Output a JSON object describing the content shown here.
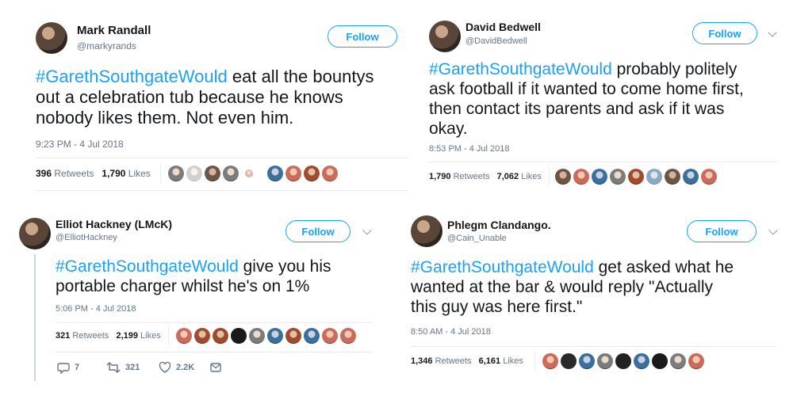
{
  "tweets": [
    {
      "name": "Mark Randall",
      "handle": "@markyrands",
      "follow": "Follow",
      "hashtag": "#GarethSouthgateWould",
      "text_lines": [
        " eat all the bountys",
        "out a celebration tub because he knows",
        "nobody likes them. Not even him."
      ],
      "timestamp": "9:23 PM - 4 Jul 2018",
      "retweets": "396",
      "retweets_label": "Retweets",
      "likes": "1,790",
      "likes_label": "Likes"
    },
    {
      "name": "David Bedwell",
      "handle": "@DavidBedwell",
      "follow": "Follow",
      "hashtag": "#GarethSouthgateWould",
      "text_lines": [
        " probably politely",
        "ask football if it wanted to come home first,",
        "then contact its parents and ask if it was",
        "okay."
      ],
      "timestamp": "8:53 PM - 4 Jul 2018",
      "retweets": "1,790",
      "retweets_label": "Retweets",
      "likes": "7,062",
      "likes_label": "Likes"
    },
    {
      "name": "Elliot Hackney (LMcK)",
      "handle": "@ElliotHackney",
      "follow": "Follow",
      "hashtag": "#GarethSouthgateWould",
      "text_lines": [
        " give you his",
        "portable charger whilst he's on 1%"
      ],
      "timestamp": "5:06 PM - 4 Jul 2018",
      "retweets": "321",
      "retweets_label": "Retweets",
      "likes": "2,199",
      "likes_label": "Likes",
      "actions": {
        "replies": "7",
        "retweets": "321",
        "likes": "2.2K"
      }
    },
    {
      "name": "Phlegm Clandango.",
      "handle": "@Cain_Unable",
      "follow": "Follow",
      "hashtag": "#GarethSouthgateWould",
      "text_lines": [
        " get asked what he",
        "wanted at the bar & would reply \"Actually",
        "this guy was here first.\""
      ],
      "timestamp": "8:50 AM - 4 Jul 2018",
      "retweets": "1,346",
      "retweets_label": "Retweets",
      "likes": "6,161",
      "likes_label": "Likes"
    }
  ],
  "icons": [
    "chevron-down-icon",
    "reply-icon",
    "retweet-icon",
    "like-icon",
    "share-icon"
  ],
  "colors": {
    "accent": "#1da1f2",
    "text": "#14171a",
    "muted": "#657786",
    "border": "#e6ecf0"
  }
}
